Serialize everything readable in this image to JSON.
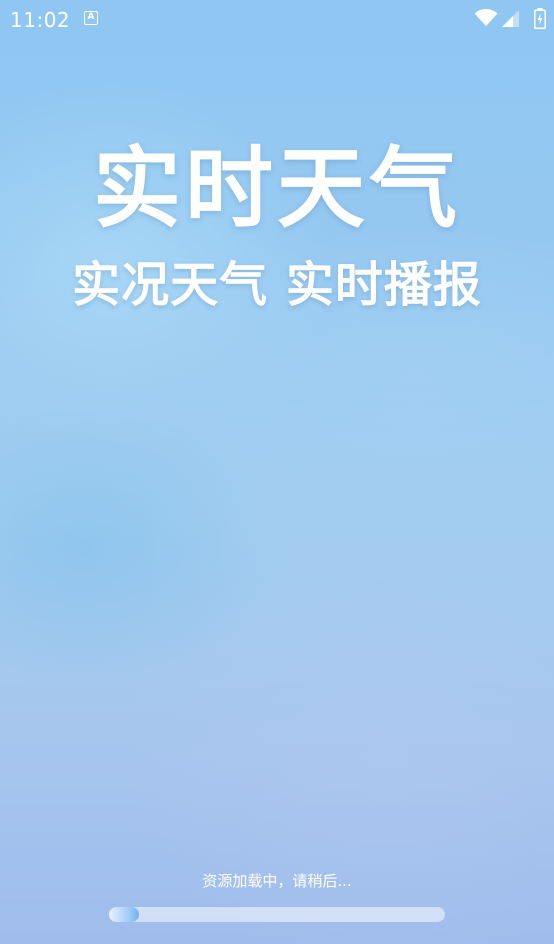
{
  "status_bar": {
    "time": "11:02",
    "notification_glyph": "A",
    "icons": [
      "notification-a-icon",
      "wifi-icon",
      "cellular-signal-icon",
      "battery-charging-icon"
    ]
  },
  "splash": {
    "headline": "实时天气",
    "subheadline": "实况天气 实时播报"
  },
  "loading": {
    "text": "资源加载中，请稍后...",
    "progress_fraction": 0.09
  },
  "colors": {
    "text": "#ffffff",
    "progress_track": "#e1ebfa",
    "progress_fill": "#6fb0ef"
  }
}
